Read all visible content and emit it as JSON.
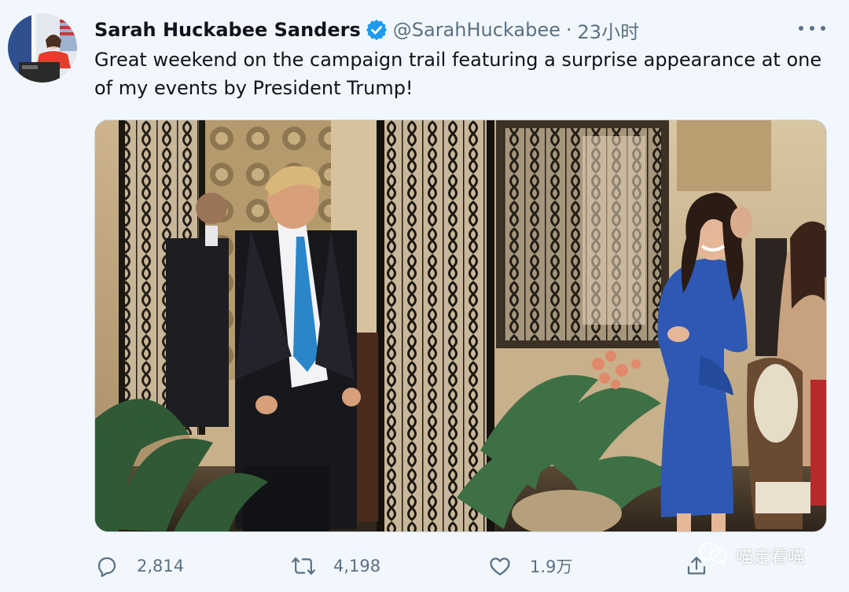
{
  "tweet": {
    "author": {
      "display_name": "Sarah Huckabee Sanders",
      "handle": "@SarahHuckabee",
      "verified_icon": "verified-badge-icon",
      "avatar_icon": "profile-avatar"
    },
    "separator": "·",
    "timestamp": "23小时",
    "more_icon": "more-options-icon",
    "text": "Great weekend on the campaign trail featuring a surprise appearance at one of my events by President Trump!",
    "media": {
      "type": "photo",
      "icon": "tweet-photo"
    },
    "actions": {
      "reply": {
        "icon": "reply-icon",
        "count": "2,814"
      },
      "retweet": {
        "icon": "retweet-icon",
        "count": "4,198"
      },
      "like": {
        "icon": "heart-icon",
        "count": "1.9万"
      },
      "share": {
        "icon": "share-icon"
      }
    }
  },
  "watermark": {
    "icon": "wechat-logo-icon",
    "text": "喵走看喵"
  },
  "colors": {
    "background": "#f1f7fd",
    "text_primary": "#0f1419",
    "text_secondary": "#5b7083",
    "verified_blue": "#1d9bf0",
    "border": "#cfd9de"
  }
}
